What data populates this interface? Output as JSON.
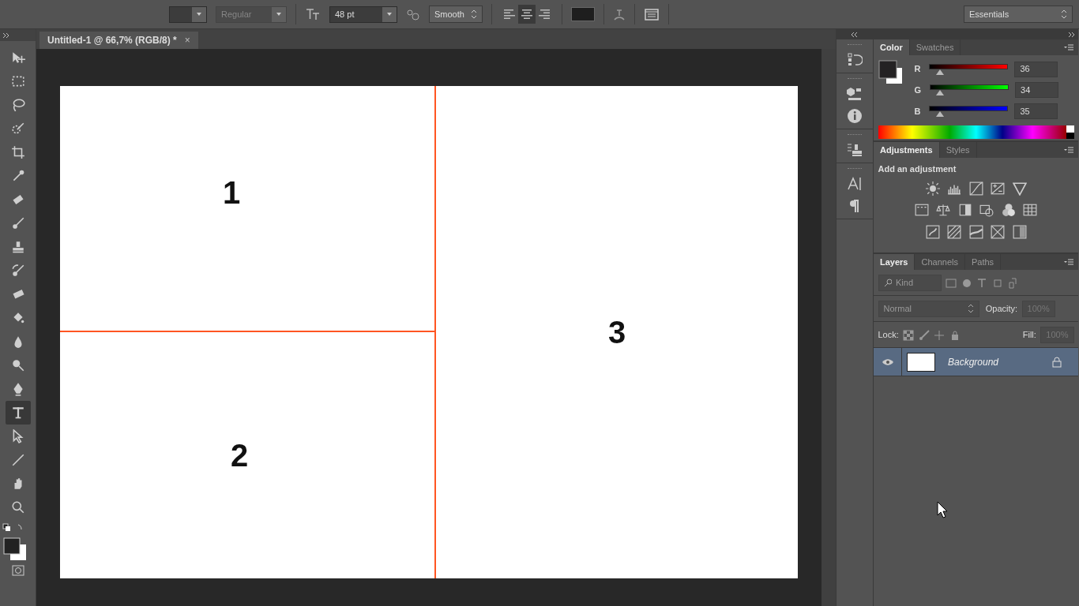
{
  "options_bar": {
    "font_style": "Regular",
    "font_size": "48 pt",
    "anti_alias": "Smooth",
    "align": [
      {
        "kind": "left",
        "selected": false
      },
      {
        "kind": "center",
        "selected": true
      },
      {
        "kind": "right",
        "selected": false
      }
    ],
    "workspace": "Essentials"
  },
  "tools": [
    {
      "kind": "move",
      "selected": false
    },
    {
      "kind": "marquee",
      "selected": false
    },
    {
      "kind": "lasso",
      "selected": false
    },
    {
      "kind": "quick-select",
      "selected": false
    },
    {
      "kind": "crop",
      "selected": false
    },
    {
      "kind": "eyedropper",
      "selected": false
    },
    {
      "kind": "healing",
      "selected": false
    },
    {
      "kind": "brush",
      "selected": false
    },
    {
      "kind": "stamp",
      "selected": false
    },
    {
      "kind": "history-brush",
      "selected": false
    },
    {
      "kind": "eraser",
      "selected": false
    },
    {
      "kind": "bucket",
      "selected": false
    },
    {
      "kind": "blur",
      "selected": false
    },
    {
      "kind": "dodge",
      "selected": false
    },
    {
      "kind": "pen",
      "selected": false
    },
    {
      "kind": "type",
      "selected": true
    },
    {
      "kind": "path-select",
      "selected": false
    },
    {
      "kind": "line",
      "selected": false
    },
    {
      "kind": "hand",
      "selected": false
    },
    {
      "kind": "zoom",
      "selected": false
    }
  ],
  "document_tab": {
    "title": "Untitled-1 @ 66,7% (RGB/8) *",
    "close": "×"
  },
  "canvas": {
    "cells": [
      {
        "label": "1"
      },
      {
        "label": "2"
      },
      {
        "label": "3"
      }
    ]
  },
  "color_panel": {
    "tabs": [
      {
        "label": "Color",
        "selected": true
      },
      {
        "label": "Swatches",
        "selected": false
      }
    ],
    "channels": [
      {
        "name": "R",
        "value": "36",
        "level": 0.14
      },
      {
        "name": "G",
        "value": "34",
        "level": 0.13
      },
      {
        "name": "B",
        "value": "35",
        "level": 0.14
      }
    ]
  },
  "adjustments_panel": {
    "tabs": [
      {
        "label": "Adjustments",
        "selected": true
      },
      {
        "label": "Styles",
        "selected": false
      }
    ],
    "heading": "Add an adjustment"
  },
  "layers_panel": {
    "tabs": [
      {
        "label": "Layers",
        "selected": true
      },
      {
        "label": "Channels",
        "selected": false
      },
      {
        "label": "Paths",
        "selected": false
      }
    ],
    "filter": "Kind",
    "blend_mode": "Normal",
    "opacity_label": "Opacity:",
    "opacity": "100%",
    "lock_label": "Lock:",
    "fill_label": "Fill:",
    "fill": "100%",
    "layers": [
      {
        "name": "Background",
        "selected": true,
        "visible": true,
        "locked": true
      }
    ]
  }
}
